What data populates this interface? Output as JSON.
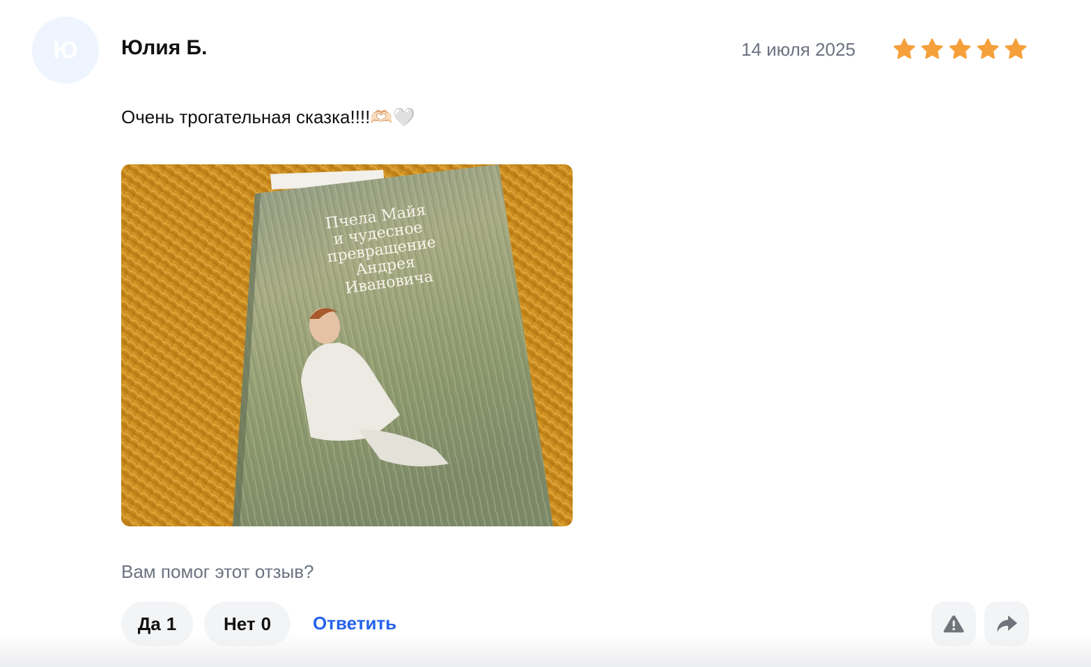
{
  "review": {
    "avatar_letter": "Ю",
    "author": "Юлия Б.",
    "date": "14 июля 2025",
    "rating": 5,
    "rating_max": 5,
    "star_color": "#f5a03a",
    "text": "Очень трогательная сказка!!!!🫶🏻🤍",
    "photo": {
      "book_title_lines": [
        "Пчела Майя",
        "и чудесное",
        "превращение",
        "Андрея",
        "Ивановича"
      ]
    }
  },
  "feedback": {
    "question": "Вам помог этот отзыв?",
    "yes_label": "Да",
    "yes_count": "1",
    "no_label": "Нет",
    "no_count": "0",
    "reply_label": "Ответить",
    "reply_color": "#2563eb"
  },
  "actions": {
    "report_icon": "warning-triangle-icon",
    "share_icon": "share-arrow-icon"
  }
}
